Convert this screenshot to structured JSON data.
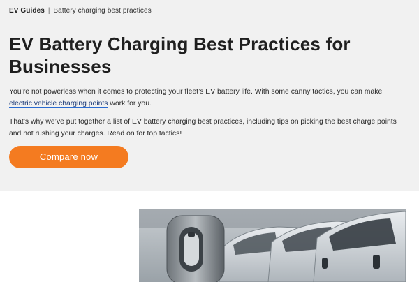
{
  "breadcrumb": {
    "parent": "EV Guides",
    "separator": "|",
    "current": "Battery charging best practices"
  },
  "page": {
    "title": "EV Battery Charging Best Practices for Businesses"
  },
  "intro": {
    "text_before_link": "You’re not powerless when it comes to protecting your fleet’s EV battery life. With some canny tactics, you can make ",
    "link_text": "electric vehicle charging points",
    "text_after_link": " work for you.",
    "paragraph_2": "That’s why we’ve put together a list of EV battery charging best practices, including tips on picking the best charge points and not rushing your charges. Read on for top tactics!"
  },
  "cta": {
    "label": "Compare now"
  },
  "image": {
    "subject": "ev-charger-with-parked-vans-photo"
  },
  "colors": {
    "hero_background": "#f1f1f1",
    "cta_background": "#f47b20",
    "link_underline": "#2a6bd1"
  }
}
